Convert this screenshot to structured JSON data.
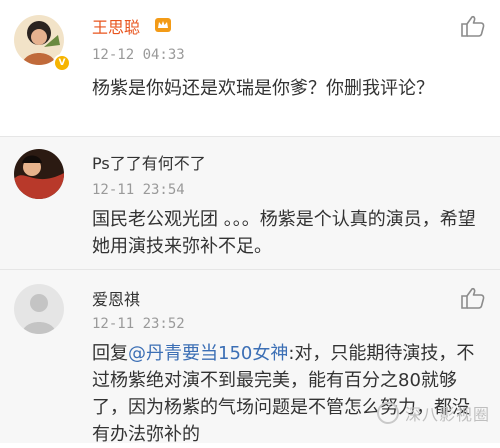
{
  "comments": [
    {
      "user_name": "王思聪",
      "verified": true,
      "time": "12-12 04:33",
      "content": "杨紫是你妈还是欢瑞是你爹？你删我评论？",
      "like_icon": "thumbs-up-icon"
    },
    {
      "user_name": "Ps了了有何不了",
      "time": "12-11 23:54",
      "content": "国民老公观光团 。。。杨紫是个认真的演员，希望她用演技来弥补不足。"
    },
    {
      "user_name": "爱恩祺",
      "time": "12-11 23:52",
      "reply_prefix": "回复",
      "mention": "@丹青要当150女神",
      "content": ":对，只能期待演技，不过杨紫绝对演不到最完美，能有百分之80就够了，因为杨紫的气场问题是不管怎么努力，都没有办法弥补的",
      "like_icon": "thumbs-up-icon"
    }
  ],
  "watermark": {
    "text": "深八影视圈"
  },
  "colors": {
    "name_highlight": "#e8551f",
    "mention": "#3c6fb5",
    "time": "#9a9a9a"
  }
}
